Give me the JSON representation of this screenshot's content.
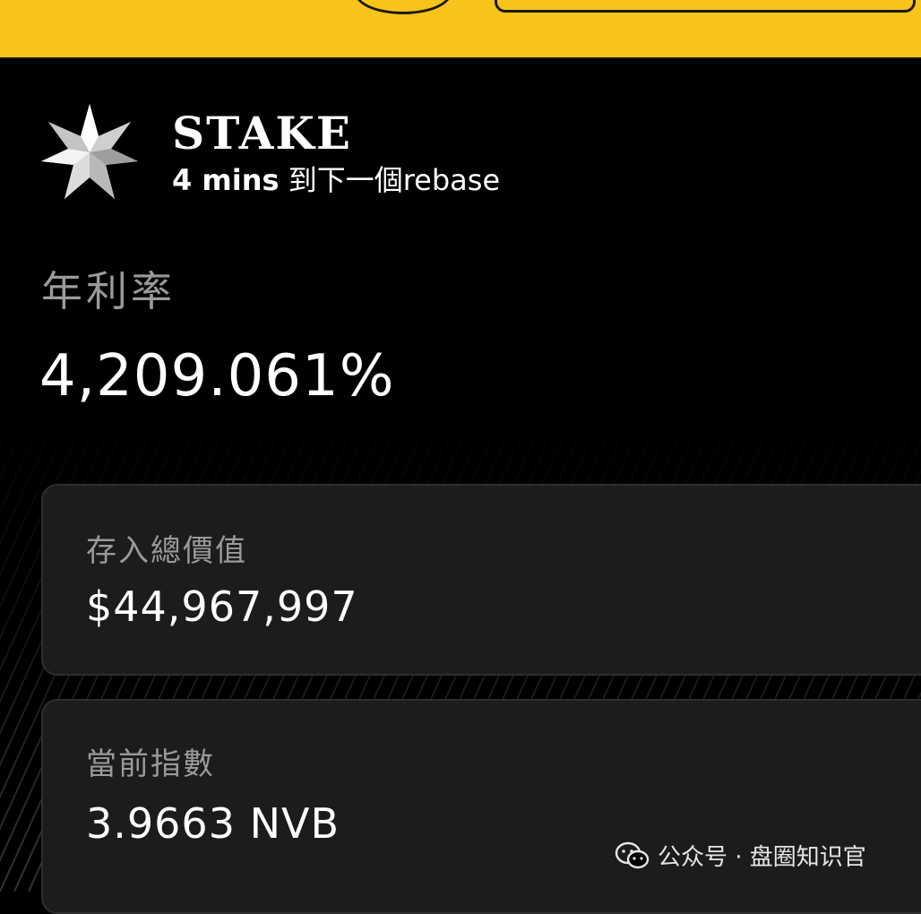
{
  "stake": {
    "title": "STAKE",
    "rebase_time": "4 mins",
    "rebase_suffix": " 到下一個rebase"
  },
  "apy": {
    "label": "年利率",
    "value": "4,209.061%"
  },
  "tvl": {
    "label": "存入總價值",
    "value": "$44,967,997"
  },
  "index": {
    "label": "當前指數",
    "value": "3.9663 NVB"
  },
  "watermark": {
    "text": "公众号 · 盘圈知识官"
  },
  "colors": {
    "top_bar": "#f9c41a",
    "background": "#000000",
    "card": "#1c1c1e",
    "muted_text": "#9a9a9a"
  },
  "icons": {
    "logo": "star-logo-icon",
    "watermark": "wechat-icon"
  }
}
